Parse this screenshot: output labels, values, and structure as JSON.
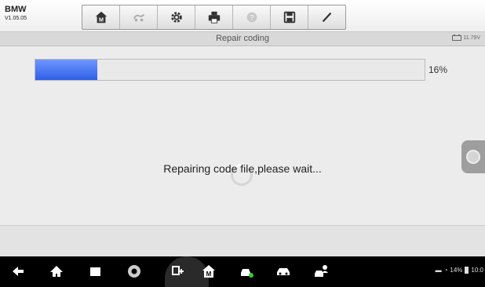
{
  "header": {
    "brand": "BMW",
    "version": "V1.05.05",
    "toolbar": [
      {
        "name": "home-icon",
        "enabled": true
      },
      {
        "name": "vehicle-swap-icon",
        "enabled": false
      },
      {
        "name": "settings-icon",
        "enabled": true
      },
      {
        "name": "print-icon",
        "enabled": true
      },
      {
        "name": "help-icon",
        "enabled": false
      },
      {
        "name": "save-icon",
        "enabled": true
      },
      {
        "name": "edit-icon",
        "enabled": true
      }
    ]
  },
  "titlebar": {
    "title": "Repair coding",
    "voltage": "11.79V"
  },
  "main": {
    "progress_percent": 16,
    "progress_label": "16%",
    "message": "Repairing code file,please wait..."
  },
  "statusbar": {
    "battery": "14%",
    "time": "10:0"
  },
  "navbar": [
    "back-icon",
    "home-icon",
    "recent-apps-icon",
    "browser-icon",
    "vci-icon",
    "maxifix-home-icon",
    "car-tools-icon",
    "car-icon",
    "user-car-icon"
  ],
  "colors": {
    "progress": "#2f5fe6",
    "navbar": "#000000"
  }
}
